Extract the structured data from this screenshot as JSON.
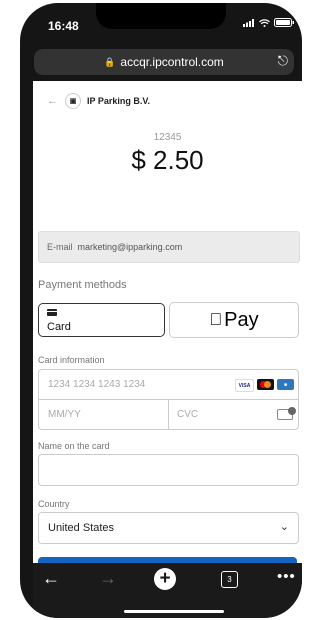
{
  "status": {
    "time": "16:48"
  },
  "browser": {
    "url": "accqr.ipcontrol.com"
  },
  "merchant": {
    "name": "IP Parking B.V."
  },
  "payment": {
    "reference": "12345",
    "amount": "$ 2.50"
  },
  "email": {
    "label": "E-mail",
    "value": "marketing@ipparking.com"
  },
  "payment_methods": {
    "title": "Payment methods",
    "card_label": "Card",
    "applepay_label": "Pay"
  },
  "card_info": {
    "title": "Card information",
    "number_placeholder": "1234 1234 1243 1234",
    "expiry_placeholder": "MM/YY",
    "cvc_placeholder": "CVC",
    "brands": [
      "VISA"
    ]
  },
  "name_on_card": {
    "title": "Name on the card",
    "value": ""
  },
  "country": {
    "title": "Country",
    "value": "United States"
  },
  "toolbar": {
    "tabs_count": "3"
  }
}
